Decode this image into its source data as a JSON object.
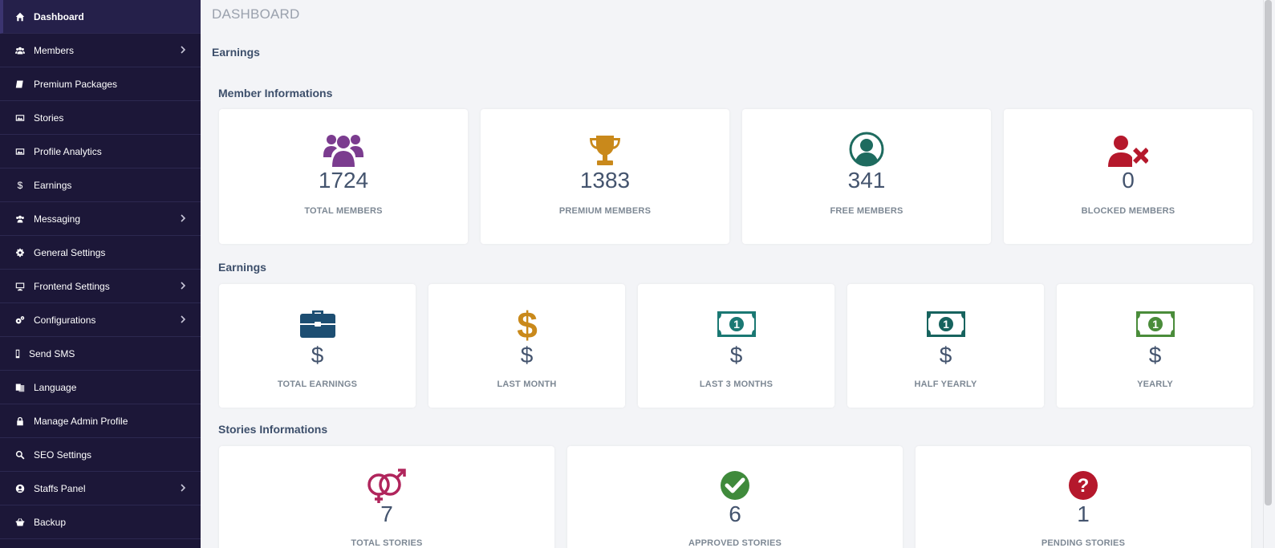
{
  "sidebar": {
    "items": [
      {
        "label": "Dashboard",
        "icon": "home-icon"
      },
      {
        "label": "Members",
        "icon": "users-icon"
      },
      {
        "label": "Premium Packages",
        "icon": "book-icon"
      },
      {
        "label": "Stories",
        "icon": "image-icon"
      },
      {
        "label": "Profile Analytics",
        "icon": "image-icon"
      },
      {
        "label": "Earnings",
        "icon": "dollar-icon"
      },
      {
        "label": "Messaging",
        "icon": "users-icon"
      },
      {
        "label": "General Settings",
        "icon": "gear-icon"
      },
      {
        "label": "Frontend Settings",
        "icon": "desktop-icon"
      },
      {
        "label": "Configurations",
        "icon": "gears-icon"
      },
      {
        "label": "Send SMS",
        "icon": "mobile-icon"
      },
      {
        "label": "Language",
        "icon": "language-icon"
      },
      {
        "label": "Manage Admin Profile",
        "icon": "lock-icon"
      },
      {
        "label": "SEO Settings",
        "icon": "search-icon"
      },
      {
        "label": "Staffs Panel",
        "icon": "user-circle-icon"
      },
      {
        "label": "Backup",
        "icon": "basket-icon"
      }
    ]
  },
  "main": {
    "page_title": "DASHBOARD",
    "earnings_heading": "Earnings",
    "member_section": {
      "title": "Member Informations",
      "cards": [
        {
          "value": "1724",
          "label": "TOTAL MEMBERS",
          "icon": "users-icon",
          "color": "#7b3c8f"
        },
        {
          "value": "1383",
          "label": "PREMIUM MEMBERS",
          "icon": "trophy-icon",
          "color": "#c9891b"
        },
        {
          "value": "341",
          "label": "FREE MEMBERS",
          "icon": "user-circle-icon",
          "color": "#1e6b5f"
        },
        {
          "value": "0",
          "label": "BLOCKED MEMBERS",
          "icon": "user-times-icon",
          "color": "#b5182c"
        }
      ]
    },
    "earnings_section": {
      "title": "Earnings",
      "cards": [
        {
          "value": "$",
          "label": "TOTAL EARNINGS",
          "icon": "briefcase-icon",
          "color": "#1d4e72"
        },
        {
          "value": "$",
          "label": "LAST MONTH",
          "icon": "dollar-icon",
          "color": "#c9891b"
        },
        {
          "value": "$",
          "label": "LAST 3 MONTHS",
          "icon": "money-bill-icon",
          "color": "#1a7873"
        },
        {
          "value": "$",
          "label": "HALF YEARLY",
          "icon": "money-bill-icon",
          "color": "#17635e"
        },
        {
          "value": "$",
          "label": "YEARLY",
          "icon": "money-bill-icon",
          "color": "#4a8c3a"
        }
      ]
    },
    "stories_section": {
      "title": "Stories Informations",
      "cards": [
        {
          "value": "7",
          "label": "TOTAL STORIES",
          "icon": "gender-icon",
          "color": "#b0255c"
        },
        {
          "value": "6",
          "label": "APPROVED STORIES",
          "icon": "check-circle-icon",
          "color": "#3f8a3b"
        },
        {
          "value": "1",
          "label": "PENDING STORIES",
          "icon": "question-circle-icon",
          "color": "#b5182c"
        }
      ]
    }
  }
}
